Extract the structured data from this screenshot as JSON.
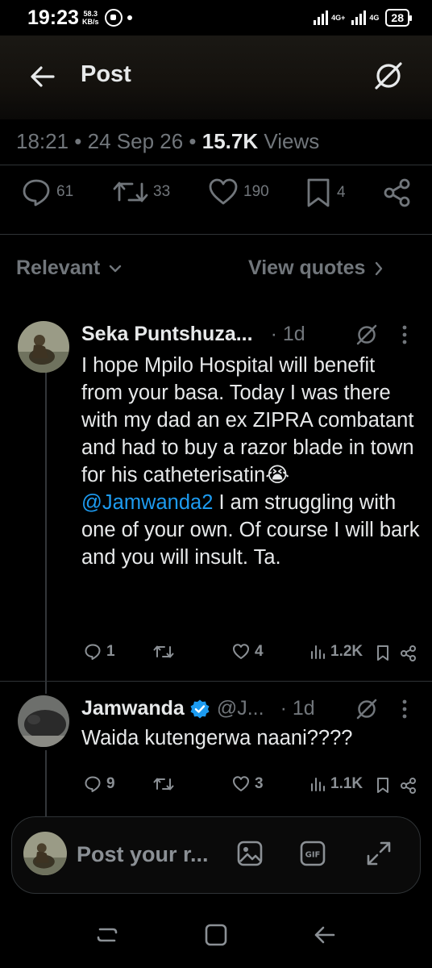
{
  "status_bar": {
    "time": "19:23",
    "speed_value": "58.3",
    "speed_unit": "KB/s",
    "net1": "4G+",
    "net2": "4G",
    "battery": "28"
  },
  "header": {
    "title": "Post"
  },
  "post_meta": {
    "time": "18:21",
    "sep1": " • ",
    "date": "24 Sep 26",
    "sep2": " • ",
    "views_count": "15.7K",
    "views_label": " Views"
  },
  "post_actions": {
    "replies": "61",
    "reposts": "33",
    "likes": "190",
    "bookmarks": "4"
  },
  "filter": {
    "sort_label": "Relevant",
    "quotes_label": "View quotes"
  },
  "replies": [
    {
      "name": "Seka Puntshuza...",
      "time": "· 1d",
      "body_part1": "I hope Mpilo Hospital will benefit from your basa. Today I was there with my dad an ex ZIPRA combatant and had to buy a razor blade in town for his catheterisatin😭",
      "mention": "@Jamwanda2",
      "body_part2": " I am struggling with one of your own. Of course I will bark and you will insult. Ta.",
      "replies": "1",
      "reposts": "",
      "likes": "4",
      "views": "1.2K"
    },
    {
      "name": "Jamwanda",
      "handle": "@J...",
      "time": "· 1d",
      "body": "Waida kutengerwa naani????",
      "replies": "9",
      "reposts": "",
      "likes": "3",
      "views": "1.1K"
    }
  ],
  "compose": {
    "placeholder": "Post your r..."
  },
  "colors": {
    "background": "#000000",
    "accent": "#1d9bf0",
    "muted": "#71767b",
    "text": "#e7e9ea"
  }
}
